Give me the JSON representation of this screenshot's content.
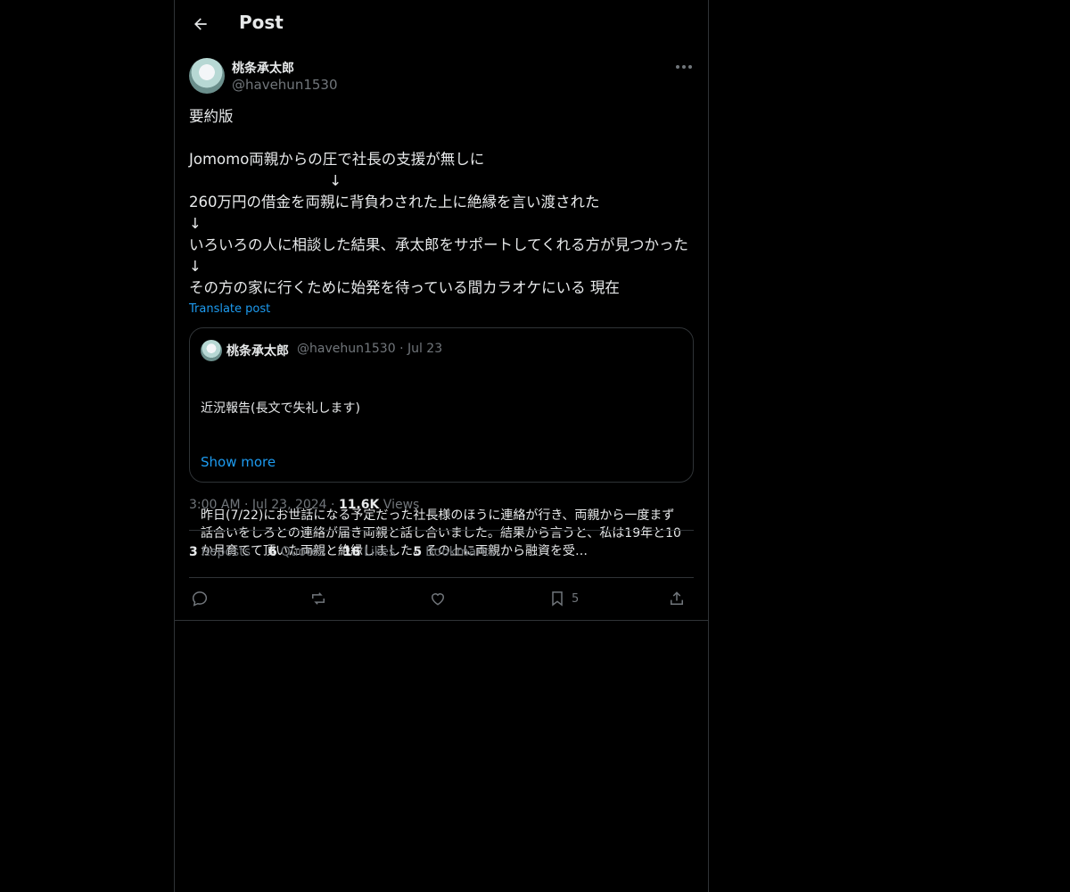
{
  "header": {
    "title": "Post"
  },
  "author": {
    "name": "桃条承太郎",
    "handle": "@havehun1530"
  },
  "post": {
    "text": "要約版\n\nJomomo両親からの圧で社長の支援が無しに\n                              ↓\n260万円の借金を両親に背負わされた上に絶縁を言い渡された\n↓\nいろいろの人に相談した結果、承太郎をサポートしてくれる方が見つかった  ↓\nその方の家に行くために始発を待っている間カラオケにいる 現在",
    "translate_label": "Translate post"
  },
  "quote": {
    "name": "桃条承太郎",
    "handle": "@havehun1530",
    "date": "Jul 23",
    "title": "近況報告(長文で失礼します)",
    "body": "昨日(7/22)にお世話になる予定だった社長様のほうに連絡が行き、両親から一度まず話合いをしろとの連絡が届き両親と話し合いました。結果から言うと、私は19年と10か月育てて頂いた両親と絶縁しました。その上に両親から融資を受…",
    "show_more": "Show more"
  },
  "meta": {
    "time": "3:00 AM",
    "date": "Jul 23, 2024",
    "views_count": "11.6K",
    "views_label": "Views"
  },
  "stats": [
    {
      "count": "3",
      "label": "Reposts"
    },
    {
      "count": "6",
      "label": "Quotes"
    },
    {
      "count": "16",
      "label": "Likes"
    },
    {
      "count": "5",
      "label": "Bookmarks"
    }
  ],
  "actions": {
    "bookmark_count": "5"
  },
  "colors": {
    "accent": "#1d9bf0",
    "muted": "#71767b",
    "border": "#2f3336",
    "text": "#e7e9ea",
    "background": "#000000"
  }
}
